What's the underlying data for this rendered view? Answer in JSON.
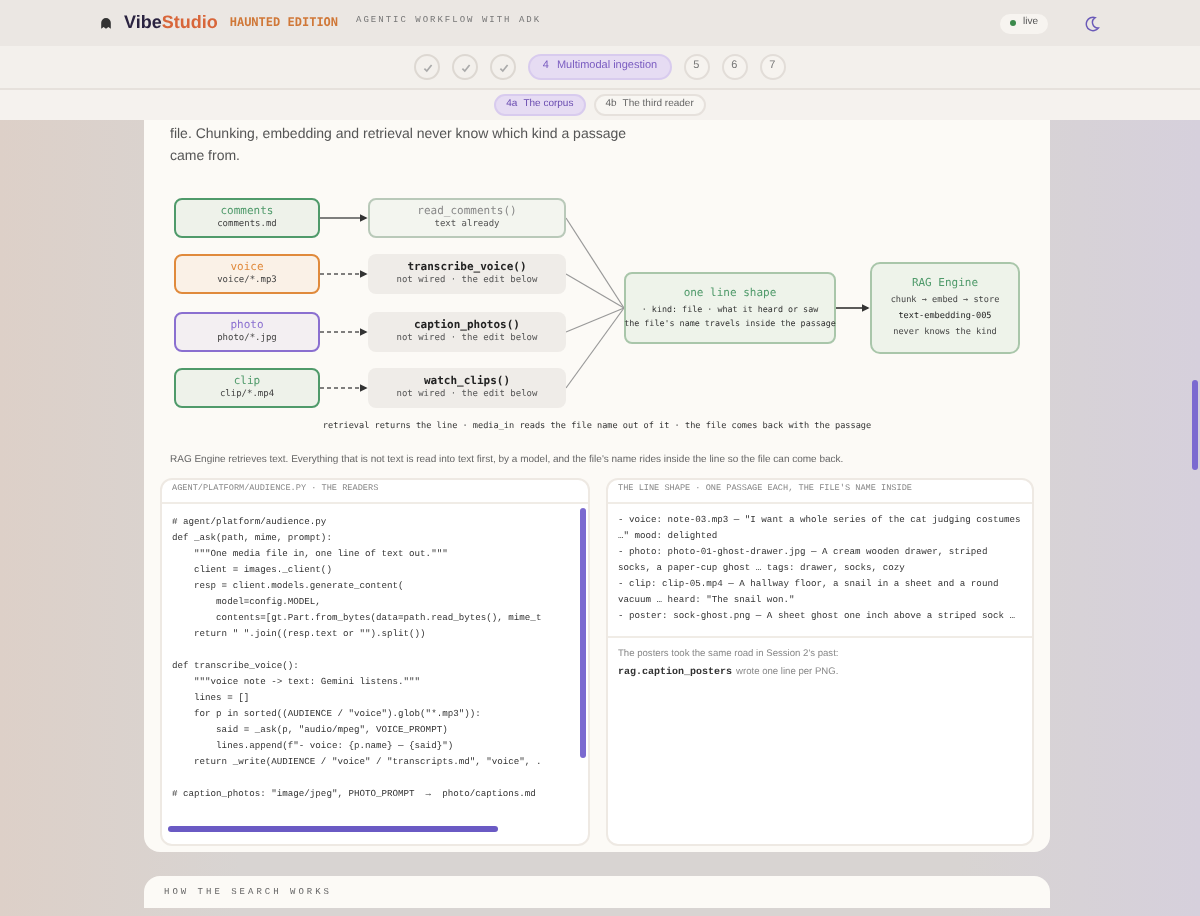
{
  "header": {
    "brand_primary": "Vibe",
    "brand_secondary": "Studio",
    "edition": "HAUNTED EDITION",
    "tagline": "AGENTIC WORKFLOW WITH ADK",
    "status": {
      "label": "live",
      "on": true
    }
  },
  "steps": [
    {
      "done": true,
      "selected": false
    },
    {
      "done": true,
      "selected": false
    },
    {
      "done": true,
      "selected": false
    },
    {
      "label": "4",
      "title": "Multimodal ingestion",
      "done": false,
      "selected": true
    },
    {
      "label": "5",
      "done": false,
      "selected": false
    },
    {
      "label": "6",
      "done": false,
      "selected": false
    },
    {
      "label": "7",
      "done": false,
      "selected": false
    }
  ],
  "subtabs": [
    {
      "label": "4a",
      "title": "The corpus",
      "selected": true
    },
    {
      "label": "4b",
      "title": "The third reader",
      "selected": false
    }
  ],
  "intro": "file. Chunking, embedding and retrieval never know which kind a passage came from.",
  "diagram": {
    "sources": [
      {
        "name": "comments",
        "path": "comments.md",
        "color": "#4f9a6a"
      },
      {
        "name": "voice",
        "path": "voice/*.mp3",
        "color": "#e08a3c"
      },
      {
        "name": "photo",
        "path": "photo/*.jpg",
        "color": "#8a6fd0"
      },
      {
        "name": "clip",
        "path": "clip/*.mp4",
        "color": "#4f9a6a"
      }
    ],
    "readers": [
      {
        "name": "read_comments()",
        "note": "text already",
        "wired": true
      },
      {
        "name": "transcribe_voice()",
        "note": "not wired · the edit below",
        "wired": false
      },
      {
        "name": "caption_photos()",
        "note": "not wired · the edit below",
        "wired": false
      },
      {
        "name": "watch_clips()",
        "note": "not wired · the edit below",
        "wired": false
      }
    ],
    "shape": {
      "title": "one line shape",
      "lines": [
        "· kind: file · what it heard or saw",
        "the file's name travels inside the passage"
      ]
    },
    "engine": {
      "title": "RAG Engine",
      "lines": [
        "chunk → embed → store",
        "text-embedding-005",
        "never knows the kind"
      ]
    },
    "caption": "retrieval returns the line · media_in reads the file name out of it · the file comes back with the passage"
  },
  "paragraph": "RAG Engine retrieves text. Everything that is not text is read into text first, by a model, and the file's name rides inside the line so the file can come back.",
  "code_panel": {
    "title": "AGENT/PLATFORM/AUDIENCE.PY · THE READERS",
    "blocks": [
      [
        "# agent/platform/audience.py",
        "def _ask(path, mime, prompt):",
        "    \"\"\"One media file in, one line of text out.\"\"\"",
        "    client = images._client()",
        "    resp = client.models.generate_content(",
        "        model=config.MODEL,",
        "        contents=[gt.Part.from_bytes(data=path.read_bytes(), mime_t",
        "    return \" \".join((resp.text or \"\").split())"
      ],
      [
        "def transcribe_voice():",
        "    \"\"\"voice note -> text: Gemini listens.\"\"\"",
        "    lines = []",
        "    for p in sorted((AUDIENCE / \"voice\").glob(\"*.mp3\")):",
        "        said = _ask(p, \"audio/mpeg\", VOICE_PROMPT)",
        "        lines.append(f\"- voice: {p.name} — {said}\")",
        "    return _write(AUDIENCE / \"voice\" / \"transcripts.md\", \"voice\", ."
      ],
      [
        "# caption_photos: \"image/jpeg\", PHOTO_PROMPT  →  photo/captions.md"
      ]
    ]
  },
  "shape_panel": {
    "title": "THE LINE SHAPE · ONE PASSAGE EACH, THE FILE'S NAME INSIDE",
    "lines": [
      "- voice: note-03.mp3 — \"I want a whole series of the cat judging costumes …\" mood: delighted",
      "- photo: photo-01-ghost-drawer.jpg — A cream wooden drawer, striped socks, a paper-cup ghost … tags: drawer, socks, cozy",
      "- clip:  clip-05.mp4 — A hallway floor, a snail in a sheet and a round vacuum … heard: \"The snail won.\"",
      "- poster: sock-ghost.png — A sheet ghost one inch above a striped sock …"
    ],
    "note": "The posters took the same road in Session 2's past:",
    "note_code": "rag.caption_posters",
    "note_tail": "wrote one line per PNG."
  },
  "next_section": {
    "title": "HOW THE SEARCH WORKS"
  }
}
